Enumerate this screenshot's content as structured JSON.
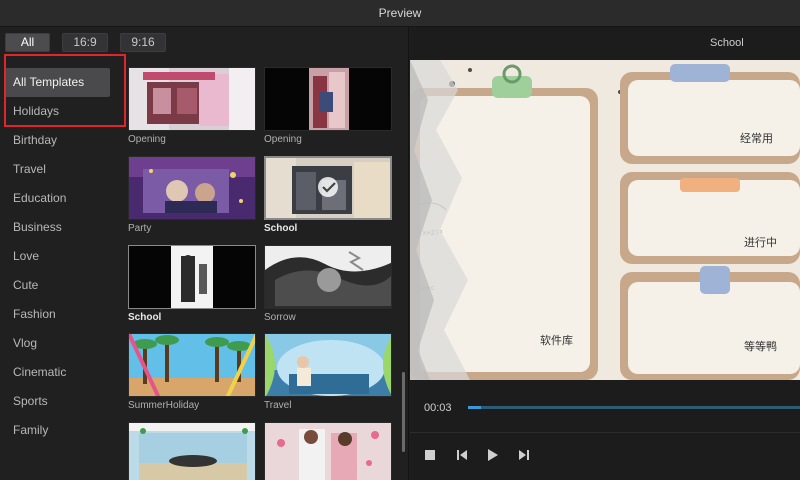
{
  "window": {
    "title": "Preview"
  },
  "ratio_tabs": [
    {
      "label": "All",
      "active": true
    },
    {
      "label": "16:9",
      "active": false
    },
    {
      "label": "9:16",
      "active": false
    }
  ],
  "categories": [
    {
      "label": "All Templates",
      "active": true
    },
    {
      "label": "Holidays"
    },
    {
      "label": "Birthday"
    },
    {
      "label": "Travel"
    },
    {
      "label": "Education"
    },
    {
      "label": "Business"
    },
    {
      "label": "Love"
    },
    {
      "label": "Cute"
    },
    {
      "label": "Fashion"
    },
    {
      "label": "Vlog"
    },
    {
      "label": "Cinematic"
    },
    {
      "label": "Sports"
    },
    {
      "label": "Family"
    }
  ],
  "templates": [
    {
      "label": "Opening",
      "bold": false,
      "selected": false
    },
    {
      "label": "Opening",
      "bold": false,
      "selected": false
    },
    {
      "label": "Party",
      "bold": false,
      "selected": false
    },
    {
      "label": "School",
      "bold": true,
      "selected": true
    },
    {
      "label": "School",
      "bold": true,
      "selected": false
    },
    {
      "label": "Sorrow",
      "bold": false,
      "selected": false
    },
    {
      "label": "SummerHoliday",
      "bold": false,
      "selected": false
    },
    {
      "label": "Travel",
      "bold": false,
      "selected": false
    },
    {
      "label": "",
      "bold": false,
      "selected": false
    },
    {
      "label": "",
      "bold": false,
      "selected": false
    }
  ],
  "preview": {
    "template_name": "School",
    "texts": {
      "frequent": "经常用",
      "in_progress": "进行中",
      "library": "软件库",
      "waiting": "等等鸭"
    },
    "time": "00:03",
    "progress": 0.04
  },
  "colors": {
    "accent": "#3a9ad6",
    "highlight": "#e0262b",
    "card": "#f5f0e8",
    "card_border": "#c8a88a"
  }
}
